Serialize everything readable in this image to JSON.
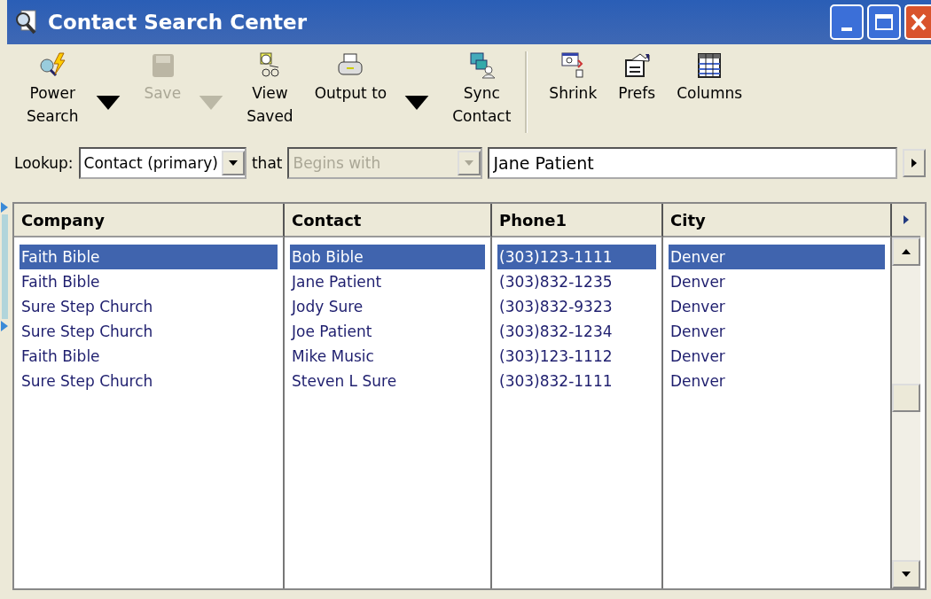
{
  "window": {
    "title": "Contact Search Center"
  },
  "toolbar": [
    {
      "kind": "button",
      "label": "Power\nSearch",
      "disabled": false,
      "dropdown": true
    },
    {
      "kind": "button",
      "label": "Save",
      "disabled": true,
      "dropdown": true
    },
    {
      "kind": "button",
      "label": "View\nSaved",
      "disabled": false,
      "dropdown": false
    },
    {
      "kind": "button",
      "label": "Output to",
      "disabled": false,
      "dropdown": true
    },
    {
      "kind": "button",
      "label": "Sync\nContact",
      "disabled": false,
      "dropdown": false
    },
    {
      "kind": "separator"
    },
    {
      "kind": "button",
      "label": "Shrink",
      "disabled": false,
      "dropdown": false
    },
    {
      "kind": "button",
      "label": "Prefs",
      "disabled": false,
      "dropdown": false
    },
    {
      "kind": "button",
      "label": "Columns",
      "disabled": false,
      "dropdown": false
    }
  ],
  "lookup": {
    "label": "Lookup:",
    "field": "Contact (primary)",
    "that_label": "that",
    "operator": "Begins with",
    "operator_disabled": true,
    "value": "Jane Patient"
  },
  "table": {
    "columns": [
      "Company",
      "Contact",
      "Phone1",
      "City"
    ],
    "rows": [
      {
        "cells": [
          "Faith Bible",
          "Bob Bible",
          "(303)123-1111",
          "Denver"
        ],
        "selected": true
      },
      {
        "cells": [
          "Faith Bible",
          "Jane Patient",
          "(303)832-1235",
          "Denver"
        ],
        "selected": false
      },
      {
        "cells": [
          "Sure Step Church",
          "Jody Sure",
          "(303)832-9323",
          "Denver"
        ],
        "selected": false
      },
      {
        "cells": [
          "Sure Step Church",
          "Joe Patient",
          "(303)832-1234",
          "Denver"
        ],
        "selected": false
      },
      {
        "cells": [
          "Faith Bible",
          "Mike Music",
          "(303)123-1112",
          "Denver"
        ],
        "selected": false
      },
      {
        "cells": [
          "Sure Step Church",
          "Steven L Sure",
          "(303)832-1111",
          "Denver"
        ],
        "selected": false
      }
    ]
  }
}
